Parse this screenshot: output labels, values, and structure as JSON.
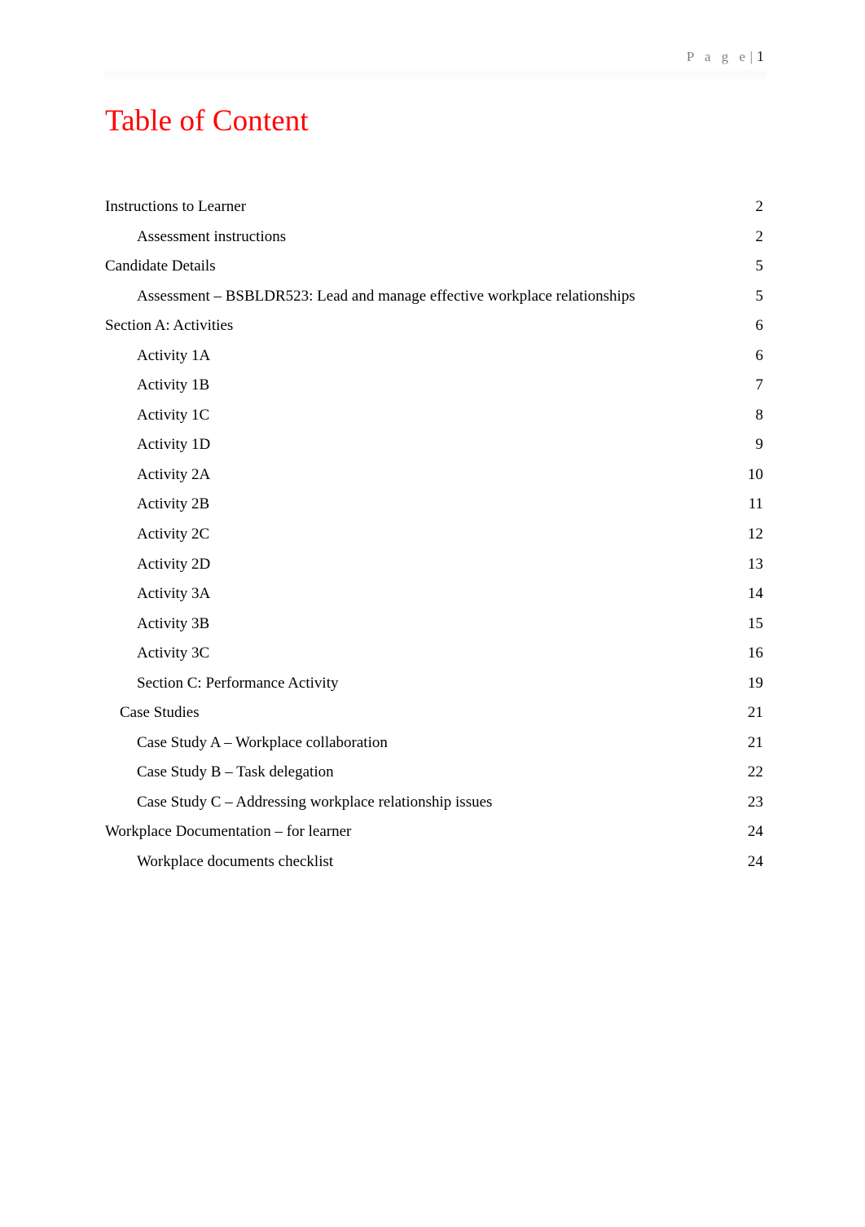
{
  "header": {
    "page_word": "P a g e",
    "separator": "|",
    "page_number": "1"
  },
  "title": "Table of Content",
  "toc": {
    "entries": [
      {
        "label": "Instructions to Learner",
        "page": "2",
        "level": 1
      },
      {
        "label": "Assessment instructions",
        "page": "2",
        "level": 2
      },
      {
        "label": "Candidate Details",
        "page": "5",
        "level": 1
      },
      {
        "label": "Assessment – BSBLDR523: Lead and manage effective workplace relationships",
        "page": "5",
        "level": 2
      },
      {
        "label": "Section A: Activities",
        "page": "6",
        "level": 1
      },
      {
        "label": "Activity 1A",
        "page": "6",
        "level": 2
      },
      {
        "label": "Activity 1B",
        "page": "7",
        "level": 2
      },
      {
        "label": "Activity 1C",
        "page": "8",
        "level": 2
      },
      {
        "label": "Activity 1D",
        "page": "9",
        "level": 2
      },
      {
        "label": "Activity 2A",
        "page": "10",
        "level": 2
      },
      {
        "label": "Activity 2B",
        "page": "11",
        "level": 2
      },
      {
        "label": "Activity 2C",
        "page": "12",
        "level": 2
      },
      {
        "label": "Activity 2D",
        "page": "13",
        "level": 2
      },
      {
        "label": "Activity 3A",
        "page": "14",
        "level": 2
      },
      {
        "label": "Activity 3B",
        "page": "15",
        "level": 2
      },
      {
        "label": "Activity 3C",
        "page": "16",
        "level": 2
      },
      {
        "label": "Section C: Performance Activity",
        "page": "19",
        "level": 2
      },
      {
        "label": "Case Studies",
        "page": "21",
        "level": 1.5
      },
      {
        "label": "Case Study A – Workplace collaboration",
        "page": "21",
        "level": 2
      },
      {
        "label": "Case Study B – Task delegation",
        "page": "22",
        "level": 2
      },
      {
        "label": "Case Study C – Addressing workplace relationship issues",
        "page": "23",
        "level": 2
      },
      {
        "label": "Workplace Documentation – for learner",
        "page": "24",
        "level": 1
      },
      {
        "label": "Workplace documents checklist",
        "page": "24",
        "level": 2
      }
    ]
  },
  "colors": {
    "title_red": "#ff0000",
    "header_gray": "#7f7f7f",
    "body_black": "#000000",
    "rule_band": "#fbfbfb"
  }
}
